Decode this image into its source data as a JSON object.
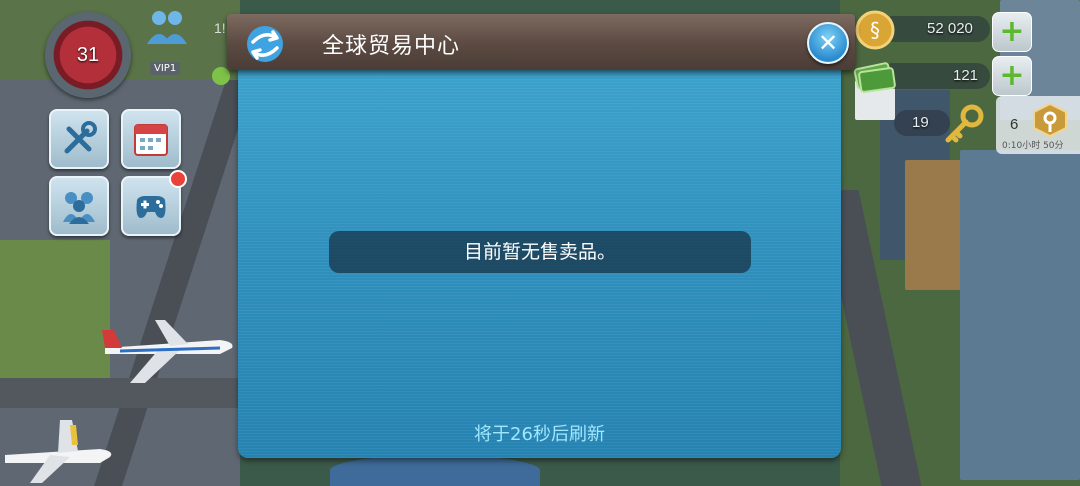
{
  "hud": {
    "level": "31",
    "population": "1!",
    "vip": "VIP1",
    "simoleons": "52 020",
    "simcash": "121",
    "keys": "19",
    "golden_keys": "6",
    "timer_hint": "0:10小时 50分"
  },
  "dialog": {
    "title": "全球贸易中心",
    "empty_message": "目前暂无售卖品。",
    "refresh_text": "将于26秒后刷新",
    "close_icon": "close-x-icon",
    "title_icon": "global-trade-icon"
  },
  "colors": {
    "header_brown": "#5b4a42",
    "body_blue": "#2f8fbc",
    "refresh_cyan": "#9fe7ff",
    "level_red": "#b3303a"
  }
}
